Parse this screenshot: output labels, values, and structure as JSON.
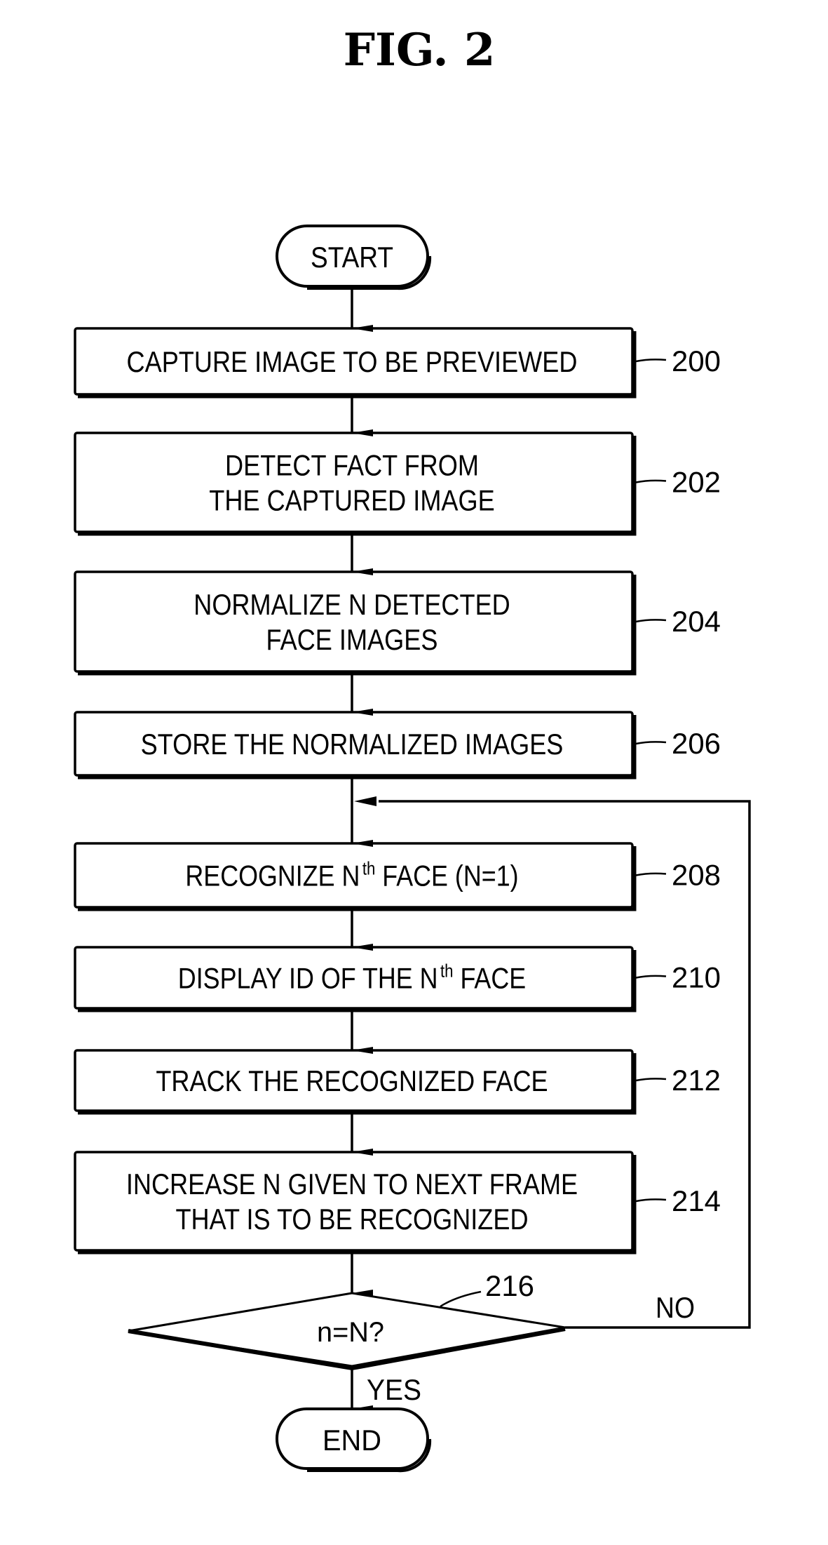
{
  "figure": {
    "title": "FIG. 2"
  },
  "colors": {
    "ink": "#000000",
    "background": "#ffffff"
  },
  "terminals": {
    "start": "START",
    "end": "END"
  },
  "steps": [
    {
      "ref": "200",
      "lines": [
        "CAPTURE IMAGE TO BE PREVIEWED"
      ]
    },
    {
      "ref": "202",
      "lines": [
        "DETECT FACT FROM",
        "THE CAPTURED IMAGE"
      ]
    },
    {
      "ref": "204",
      "lines": [
        "NORMALIZE N DETECTED",
        "FACE IMAGES"
      ]
    },
    {
      "ref": "206",
      "lines": [
        "STORE THE NORMALIZED IMAGES"
      ]
    },
    {
      "ref": "208",
      "lines": [
        [
          "RECOGNIZE N",
          "th",
          " FACE (N=1)"
        ]
      ]
    },
    {
      "ref": "210",
      "lines": [
        [
          "DISPLAY ID OF THE N",
          "th",
          " FACE"
        ]
      ]
    },
    {
      "ref": "212",
      "lines": [
        "TRACK THE RECOGNIZED FACE"
      ]
    },
    {
      "ref": "214",
      "lines": [
        "INCREASE N GIVEN TO NEXT FRAME",
        "THAT IS TO BE RECOGNIZED"
      ]
    }
  ],
  "decision": {
    "ref": "216",
    "condition": "n=N?",
    "yes_label": "YES",
    "no_label": "NO"
  }
}
